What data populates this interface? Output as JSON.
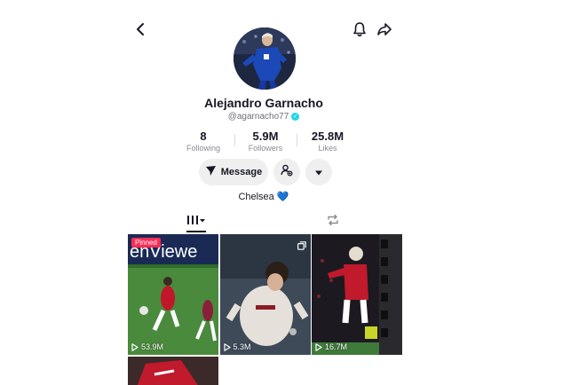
{
  "profile": {
    "display_name": "Alejandro Garnacho",
    "username": "@agarnacho77",
    "bio_text": "Chelsea",
    "bio_emoji": "💙"
  },
  "stats": [
    {
      "value": "8",
      "label": "Following"
    },
    {
      "value": "5.9M",
      "label": "Followers"
    },
    {
      "value": "25.8M",
      "label": "Likes"
    }
  ],
  "actions": {
    "message_label": "Message"
  },
  "icons": {
    "back": "chevron-left-icon",
    "notifications": "bell-icon",
    "share": "share-arrow-icon",
    "verified": "verified-badge-icon",
    "add_friend": "add-friend-icon",
    "more": "caret-down-icon",
    "videos_tab": "grid-icon",
    "reposts_tab": "repost-icon",
    "views": "play-icon"
  },
  "videos": [
    {
      "views": "53.9M",
      "badge": "Pinned"
    },
    {
      "views": "5.3M"
    },
    {
      "views": "16.7M"
    },
    {
      "views": ""
    }
  ],
  "colors": {
    "pinned_badge": "#fe2c55",
    "verified": "#20d5ec",
    "button_bg": "#efeff0"
  }
}
